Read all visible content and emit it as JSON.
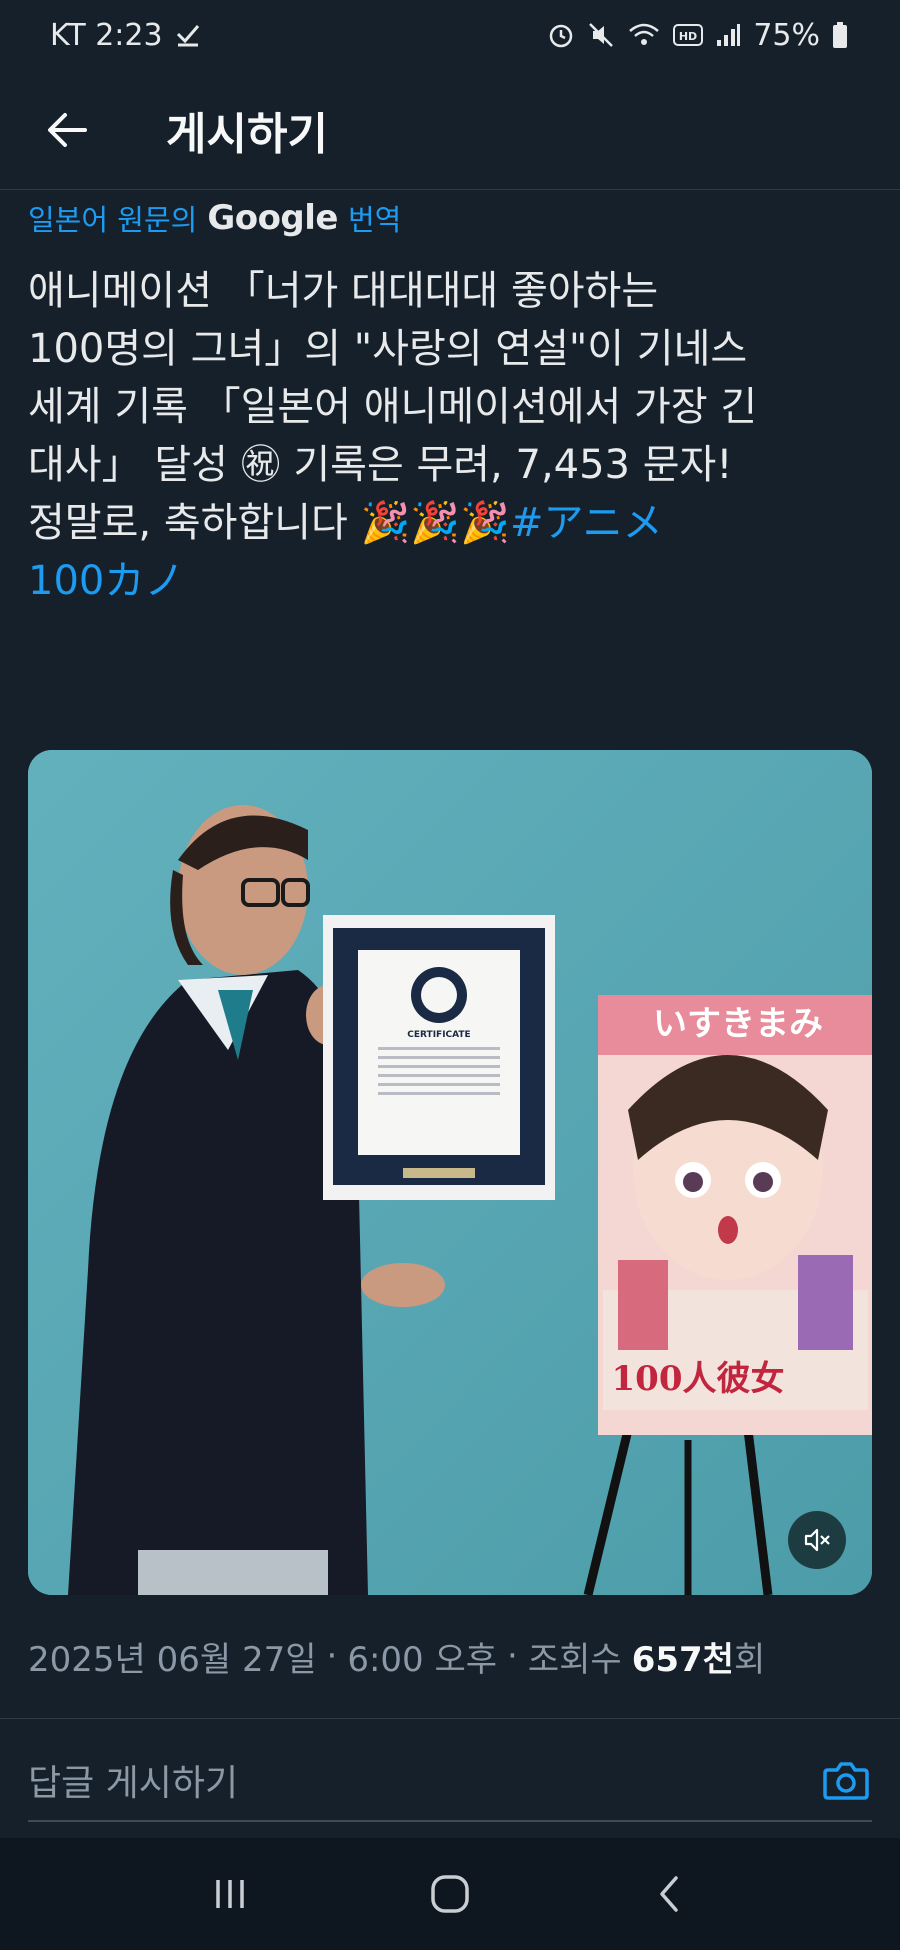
{
  "status_bar": {
    "carrier_time": "KT 2:23",
    "battery": "75%",
    "icons": [
      "check-icon",
      "alarm-icon",
      "mute-icon",
      "wifi-icon",
      "hd-icon",
      "signal-icon",
      "battery-icon"
    ]
  },
  "header": {
    "title": "게시하기",
    "back_icon": "arrow-left-icon"
  },
  "translation": {
    "prefix": "일본어 원문의",
    "brand": "Google",
    "suffix": "번역"
  },
  "post": {
    "lines": [
      "애니메이션 「너가 대대대대 좋아하는",
      "100명의 그녀」의 \"사랑의 연설\"이 기네스",
      "세계 기록 「일본어 애니메이션에서 가장 긴",
      "대사」 달성 ㊗ 기록은 무려, 7,453 문자!"
    ],
    "line5_text": "정말로, 축하합니다 🎉🎉🎉",
    "hashtag_part1": "#アニメ",
    "hashtag_part2": "100カノ"
  },
  "media": {
    "type": "video",
    "mute_icon": "speaker-muted-icon",
    "certificate_heading": "CERTIFICATE",
    "poster_text": "いすきまみ",
    "poster_title": "100人彼女"
  },
  "meta": {
    "date": "2025년 06월 27일",
    "time": "6:00 오후",
    "views_label": "조회수",
    "views_count": "657천",
    "views_suffix": "회"
  },
  "reply": {
    "placeholder": "답글 게시하기",
    "camera_icon": "camera-icon"
  },
  "nav_bar": {
    "icons": [
      "recent-apps-icon",
      "home-icon",
      "back-icon"
    ]
  },
  "colors": {
    "background": "#15202b",
    "accent": "#1d9bf0",
    "text_primary": "#e7e9ea",
    "text_secondary": "#8b98a5"
  }
}
